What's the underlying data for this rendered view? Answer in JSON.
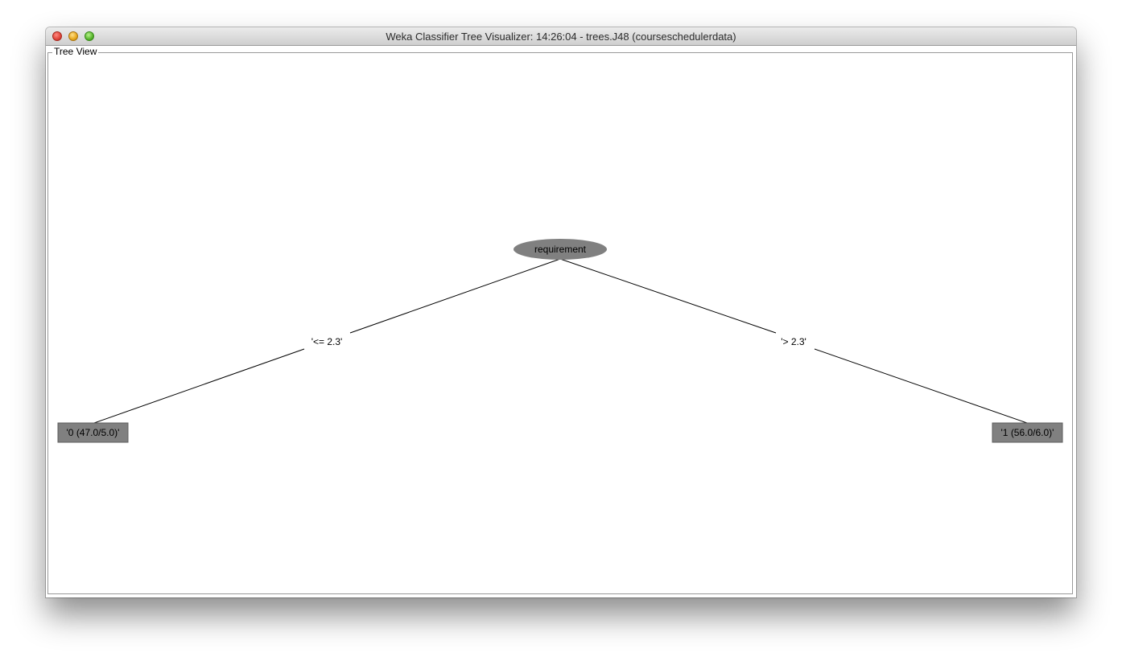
{
  "window": {
    "title": "Weka Classifier Tree Visualizer: 14:26:04 - trees.J48 (courseschedulerdata)"
  },
  "panel": {
    "label": "Tree View"
  },
  "tree": {
    "root": {
      "label": "requirement",
      "shape": "ellipse"
    },
    "edges": [
      {
        "label": "'<= 2.3'"
      },
      {
        "label": "'> 2.3'"
      }
    ],
    "leaves": [
      {
        "label": "'0 (47.0/5.0)'",
        "shape": "rectangle"
      },
      {
        "label": "'1 (56.0/6.0)'",
        "shape": "rectangle"
      }
    ],
    "node_color": "#808080"
  }
}
